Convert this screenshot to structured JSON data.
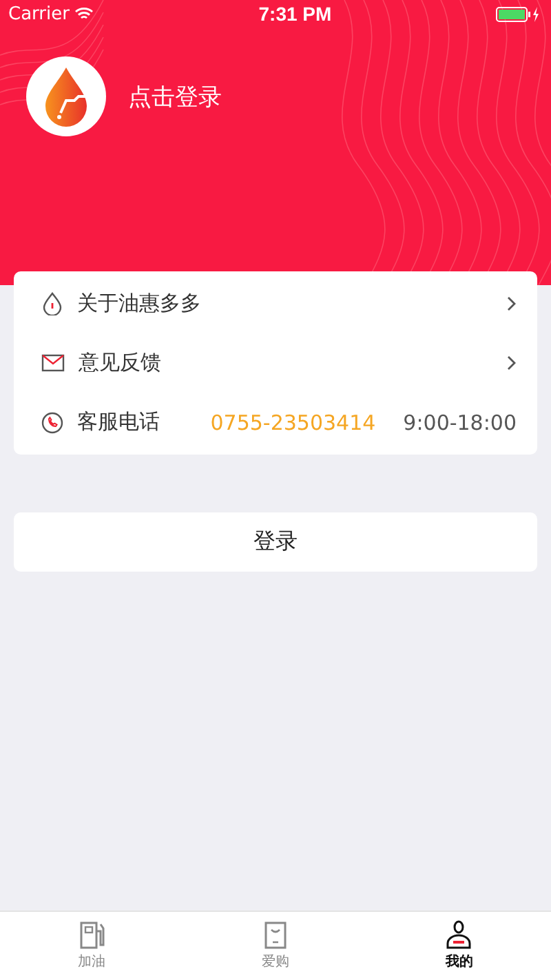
{
  "status_bar": {
    "carrier": "Carrier",
    "time": "7:31 PM"
  },
  "header": {
    "login_prompt": "点击登录"
  },
  "menu": [
    {
      "kind": "about",
      "label": "关于油惠多多"
    },
    {
      "kind": "feedback",
      "label": "意见反馈"
    },
    {
      "kind": "phone",
      "label": "客服电话",
      "phone": "0755-23503414",
      "hours": "9:00-18:00"
    }
  ],
  "login_button": "登录",
  "tabs": [
    {
      "kind": "fuel",
      "label": "加油",
      "selected": false
    },
    {
      "kind": "shop",
      "label": "爱购",
      "selected": false
    },
    {
      "kind": "profile",
      "label": "我的",
      "selected": true
    }
  ]
}
